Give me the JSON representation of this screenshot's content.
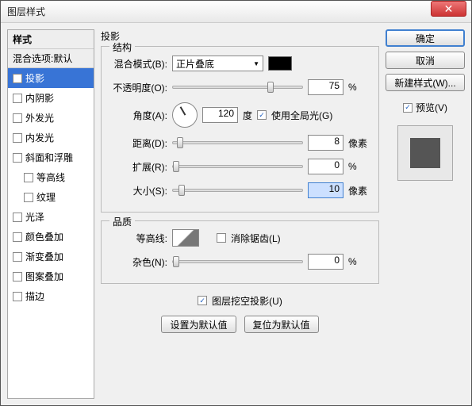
{
  "window": {
    "title": "图层样式"
  },
  "left": {
    "header": "样式",
    "blend": "混合选项:默认",
    "items": [
      {
        "label": "投影",
        "checked": true,
        "selected": true
      },
      {
        "label": "内阴影",
        "checked": false
      },
      {
        "label": "外发光",
        "checked": false
      },
      {
        "label": "内发光",
        "checked": false
      },
      {
        "label": "斜面和浮雕",
        "checked": false
      },
      {
        "label": "等高线",
        "checked": false,
        "indent": true
      },
      {
        "label": "纹理",
        "checked": false,
        "indent": true
      },
      {
        "label": "光泽",
        "checked": false
      },
      {
        "label": "颜色叠加",
        "checked": false
      },
      {
        "label": "渐变叠加",
        "checked": false
      },
      {
        "label": "图案叠加",
        "checked": false
      },
      {
        "label": "描边",
        "checked": false
      }
    ]
  },
  "middle": {
    "title": "投影",
    "structure": {
      "label": "结构",
      "blend_mode_label": "混合模式(B):",
      "blend_mode_value": "正片叠底",
      "color": "#000000",
      "opacity_label": "不透明度(O):",
      "opacity_value": "75",
      "opacity_unit": "%",
      "angle_label": "角度(A):",
      "angle_value": "120",
      "angle_unit": "度",
      "global_label": "使用全局光(G)",
      "global_checked": true,
      "distance_label": "距离(D):",
      "distance_value": "8",
      "distance_unit": "像素",
      "spread_label": "扩展(R):",
      "spread_value": "0",
      "spread_unit": "%",
      "size_label": "大小(S):",
      "size_value": "10",
      "size_unit": "像素"
    },
    "quality": {
      "label": "品质",
      "contour_label": "等高线:",
      "antialias_label": "消除锯齿(L)",
      "antialias_checked": false,
      "noise_label": "杂色(N):",
      "noise_value": "0",
      "noise_unit": "%"
    },
    "knockout_label": "图层挖空投影(U)",
    "knockout_checked": true,
    "btn_default": "设置为默认值",
    "btn_reset": "复位为默认值"
  },
  "right": {
    "ok": "确定",
    "cancel": "取消",
    "new_style": "新建样式(W)...",
    "preview_label": "预览(V)",
    "preview_checked": true
  }
}
